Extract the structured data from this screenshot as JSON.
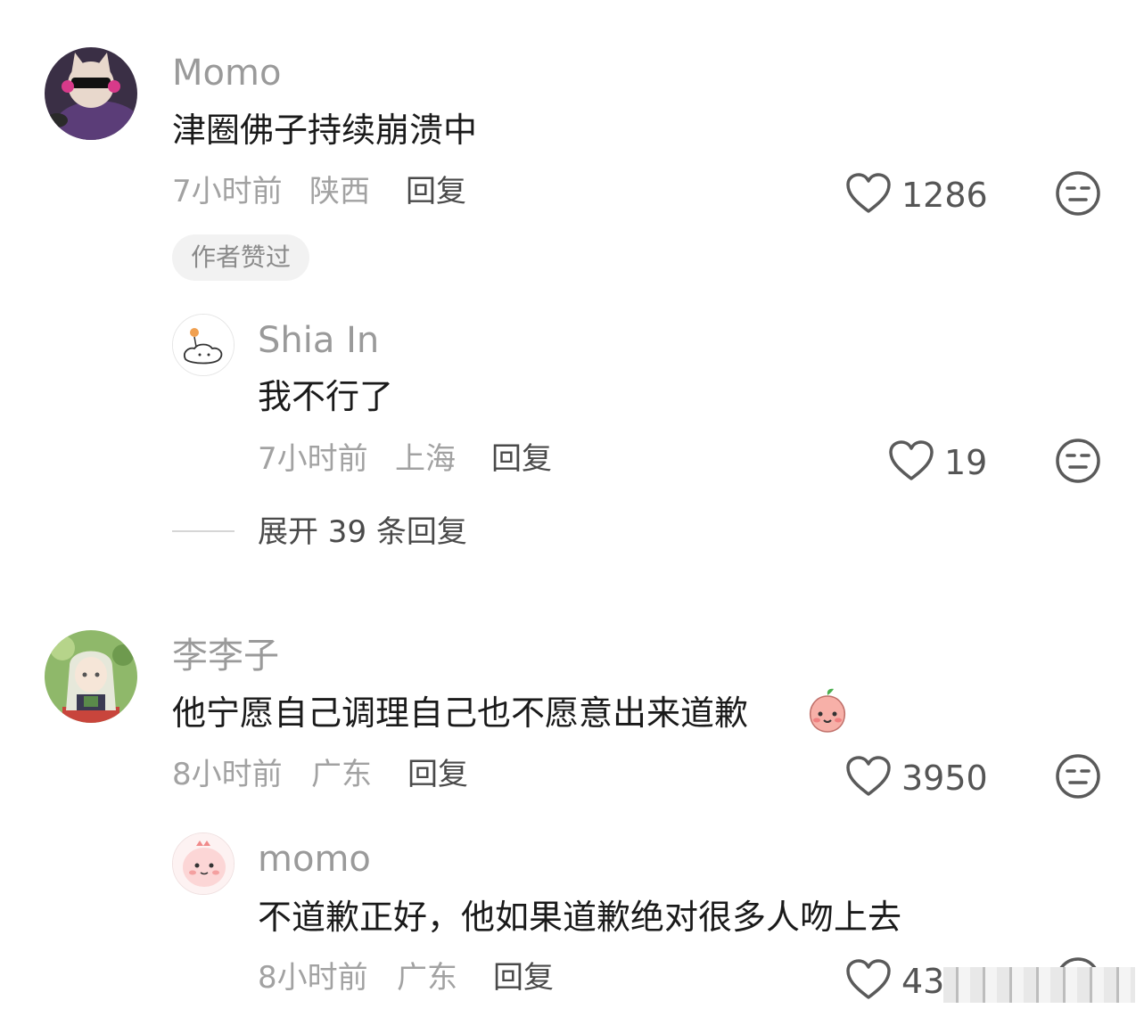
{
  "comments": [
    {
      "username": "Momo",
      "text": "津圈佛子持续崩溃中",
      "time": "7小时前",
      "location": "陕西",
      "reply_label": "回复",
      "likes": "1286",
      "badge": "作者赞过",
      "avatar_icon": "cat-sunglasses-avatar"
    },
    {
      "username": "Shia In",
      "text": "我不行了",
      "time": "7小时前",
      "location": "上海",
      "reply_label": "回复",
      "likes": "19",
      "avatar_icon": "cloud-sketch-avatar"
    },
    {
      "username": "李李子",
      "text": "他宁愿自己调理自己也不愿意出来道歉",
      "time": "8小时前",
      "location": "广东",
      "reply_label": "回复",
      "likes": "3950",
      "avatar_icon": "anime-girl-avatar",
      "emoji": "peach-face-emoji"
    },
    {
      "username": "momo",
      "text": "不道歉正好，他如果道歉绝对很多人吻上去",
      "time": "8小时前",
      "location": "广东",
      "reply_label": "回复",
      "likes": "43",
      "avatar_icon": "pink-dino-avatar"
    }
  ],
  "expand_replies": "展开 39 条回复",
  "colors": {
    "username": "#9a9a9a",
    "text": "#1a1a1a",
    "meta": "#a2a2a2",
    "icon": "#5a5a5a"
  }
}
